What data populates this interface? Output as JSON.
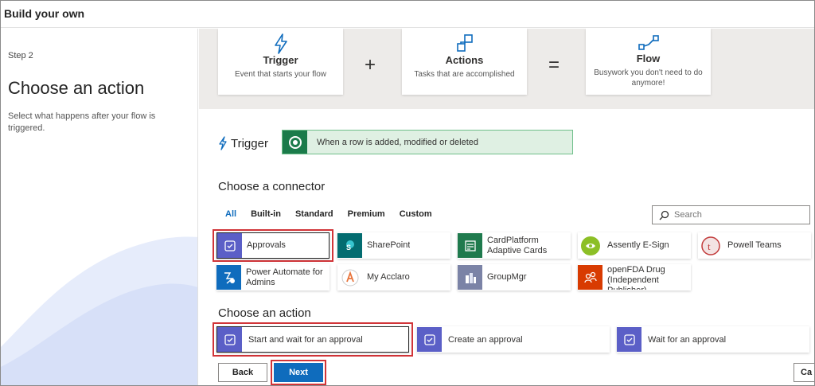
{
  "window": {
    "title": "Build your own"
  },
  "left": {
    "step": "Step 2",
    "title": "Choose an action",
    "description": "Select what happens after your flow is triggered."
  },
  "banner": {
    "trigger": {
      "title": "Trigger",
      "subtitle": "Event that starts your flow"
    },
    "plus": "+",
    "actions": {
      "title": "Actions",
      "subtitle": "Tasks that are accomplished"
    },
    "equals": "=",
    "flow": {
      "title": "Flow",
      "subtitle": "Busywork you don't need to do anymore!"
    }
  },
  "trigger": {
    "label": "Trigger",
    "value": "When a row is added, modified or deleted"
  },
  "connectors": {
    "heading": "Choose a connector",
    "tabs": [
      "All",
      "Built-in",
      "Standard",
      "Premium",
      "Custom"
    ],
    "active_tab": "All",
    "search_placeholder": "Search",
    "items": [
      {
        "label": "Approvals",
        "icon": "approvals-icon",
        "color": "#5b5fc7"
      },
      {
        "label": "SharePoint",
        "icon": "sharepoint-icon",
        "color": "#036c70"
      },
      {
        "label": "CardPlatform Adaptive Cards",
        "icon": "cardplatform-icon",
        "color": "#1f7a4d"
      },
      {
        "label": "Assently E-Sign",
        "icon": "assently-icon",
        "color": "#8cbf26"
      },
      {
        "label": "Powell Teams",
        "icon": "powell-icon",
        "color": "#c23b3b"
      },
      {
        "label": "Power Automate for Admins",
        "icon": "power-automate-icon",
        "color": "#0f6cbd"
      },
      {
        "label": "My Acclaro",
        "icon": "acclaro-icon",
        "color": "#e8743b"
      },
      {
        "label": "GroupMgr",
        "icon": "groupmgr-icon",
        "color": "#7b83a6"
      },
      {
        "label": "openFDA Drug (Independent Publisher)",
        "icon": "openfda-icon",
        "color": "#d83b01"
      }
    ]
  },
  "actions": {
    "heading": "Choose an action",
    "items": [
      {
        "label": "Start and wait for an approval"
      },
      {
        "label": "Create an approval"
      },
      {
        "label": "Wait for an approval"
      }
    ]
  },
  "buttons": {
    "back": "Back",
    "next": "Next",
    "cancel": "Ca"
  },
  "colors": {
    "accent": "#0f6cbd",
    "highlight": "#d13438",
    "approvals": "#5b5fc7",
    "trigger_bg": "#dff0e3"
  }
}
